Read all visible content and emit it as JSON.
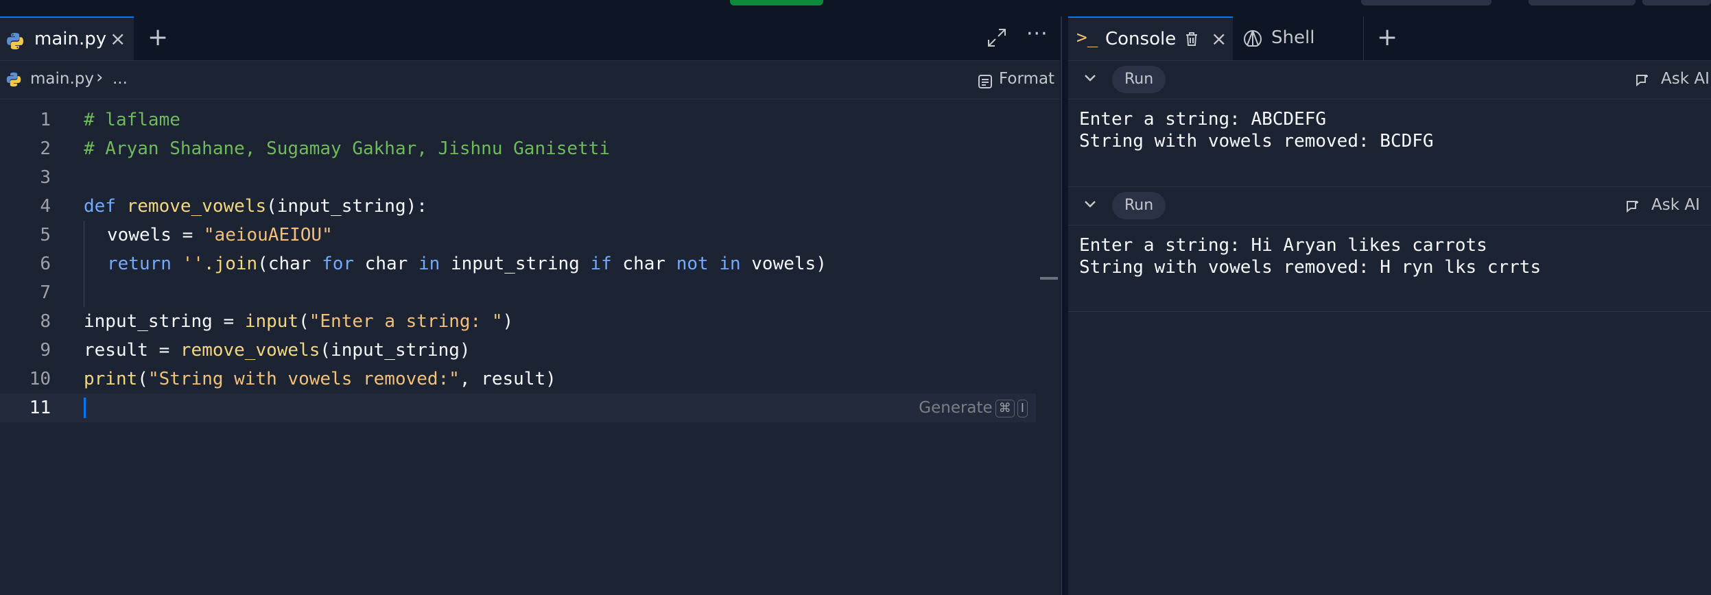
{
  "editor": {
    "tab_name": "main.py",
    "breadcrumb_file": "main.py",
    "breadcrumb_sep": "›",
    "breadcrumb_more": "...",
    "format_label": "Format",
    "generate_label": "Generate",
    "generate_keys": [
      "⌘",
      "I"
    ],
    "lines": [
      {
        "n": "1"
      },
      {
        "n": "2"
      },
      {
        "n": "3"
      },
      {
        "n": "4"
      },
      {
        "n": "5"
      },
      {
        "n": "6"
      },
      {
        "n": "7"
      },
      {
        "n": "8"
      },
      {
        "n": "9"
      },
      {
        "n": "10"
      },
      {
        "n": "11"
      }
    ],
    "code": {
      "l1": "# laflame",
      "l2": "# Aryan Shahane, Sugamay Gakhar, Jishnu Ganisetti",
      "l4_kw": "def",
      "l4_fn": "remove_vowels",
      "l4_rest": "(input_string):",
      "l5_var": "vowels = ",
      "l5_str": "\"aeiouAEIOU\"",
      "l6_kw": "return",
      "l6_str": "''",
      "l6_join": ".join",
      "l6_a": "(char ",
      "l6_for": "for",
      "l6_b": " char ",
      "l6_in1": "in",
      "l6_c": " input_string ",
      "l6_if": "if",
      "l6_d": " char ",
      "l6_not": "not",
      "l6_e": " ",
      "l6_in2": "in",
      "l6_f": " vowels)",
      "l8_var": "input_string = ",
      "l8_fn": "input",
      "l8_p1": "(",
      "l8_str": "\"Enter a string: \"",
      "l8_p2": ")",
      "l9_var": "result = ",
      "l9_fn": "remove_vowels",
      "l9_rest": "(input_string)",
      "l10_fn": "print",
      "l10_p1": "(",
      "l10_str": "\"String with vowels removed:\"",
      "l10_rest": ", result)"
    }
  },
  "console": {
    "tab_console": "Console",
    "tab_shell": "Shell",
    "run_label": "Run",
    "ask_ai_label": "Ask AI",
    "runs": [
      {
        "line1": "Enter a string: ABCDEFG",
        "line2": "String with vowels removed: BCDFG"
      },
      {
        "line1": "Enter a string: Hi Aryan likes carrots",
        "line2": "String with vowels removed: H ryn lks crrts"
      }
    ]
  },
  "colors": {
    "background": "#1c2333",
    "chrome": "#0e1525",
    "accent": "#0079f2",
    "comment": "#6fba5a",
    "keyword": "#73a9ff",
    "function": "#f2d77e",
    "string": "#f2c078"
  },
  "icons": [
    "python-icon",
    "close-icon",
    "plus-icon",
    "expand-icon",
    "more-icon",
    "format-icon",
    "console-prompt-icon",
    "trash-icon",
    "shell-icon",
    "chevron-down-icon",
    "ask-ai-icon"
  ]
}
